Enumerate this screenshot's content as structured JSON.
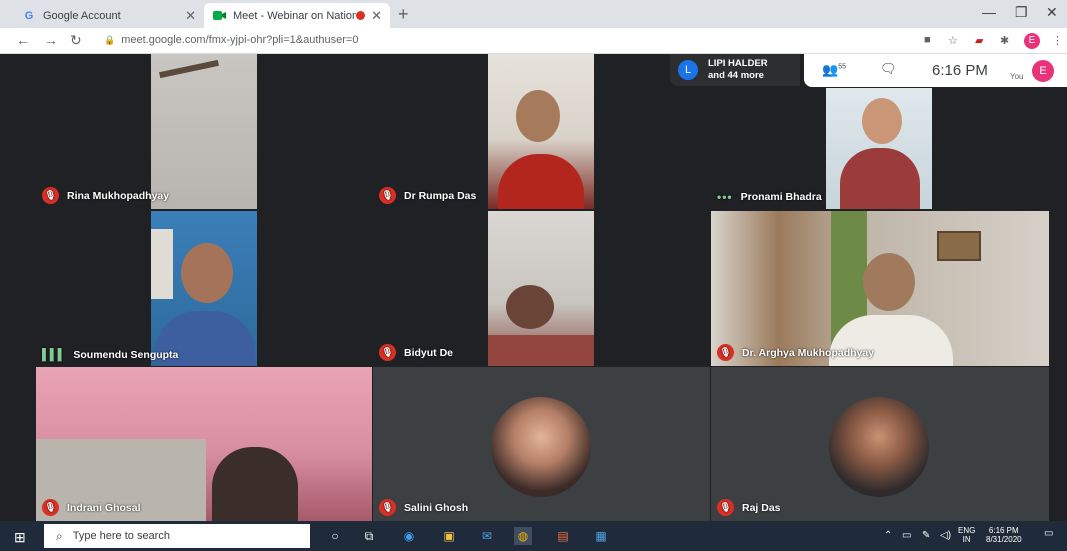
{
  "browser": {
    "tabs": [
      {
        "label": "Google Account",
        "favicon": "G"
      },
      {
        "label": "Meet - Webinar on National"
      }
    ],
    "url": "meet.google.com/fmx-yjpi-ohr?pli=1&authuser=0",
    "profile_initial": "E"
  },
  "meet": {
    "presenter_initial": "L",
    "presenter_line1": "LIPI HALDER",
    "presenter_line2": "and 44 more",
    "participant_count": "55",
    "time": "6:16 PM",
    "you_label": "You",
    "user_initial": "E",
    "participants": [
      {
        "name": "Rina Mukhopadhyay",
        "status": "muted"
      },
      {
        "name": "Dr Rumpa Das",
        "status": "muted"
      },
      {
        "name": "Pronami Bhadra",
        "status": "dots"
      },
      {
        "name": "Soumendu Sengupta",
        "status": "speaking"
      },
      {
        "name": "Bidyut De",
        "status": "muted"
      },
      {
        "name": "Dr. Arghya Mukhopadhyay",
        "status": "muted"
      },
      {
        "name": "Indrani Ghosal",
        "status": "muted"
      },
      {
        "name": "Salini Ghosh",
        "status": "muted"
      },
      {
        "name": "Raj Das",
        "status": "muted"
      }
    ]
  },
  "taskbar": {
    "search_placeholder": "Type here to search",
    "lang_line1": "ENG",
    "lang_line2": "IN",
    "clock_time": "6:16 PM",
    "clock_date": "8/31/2020"
  }
}
